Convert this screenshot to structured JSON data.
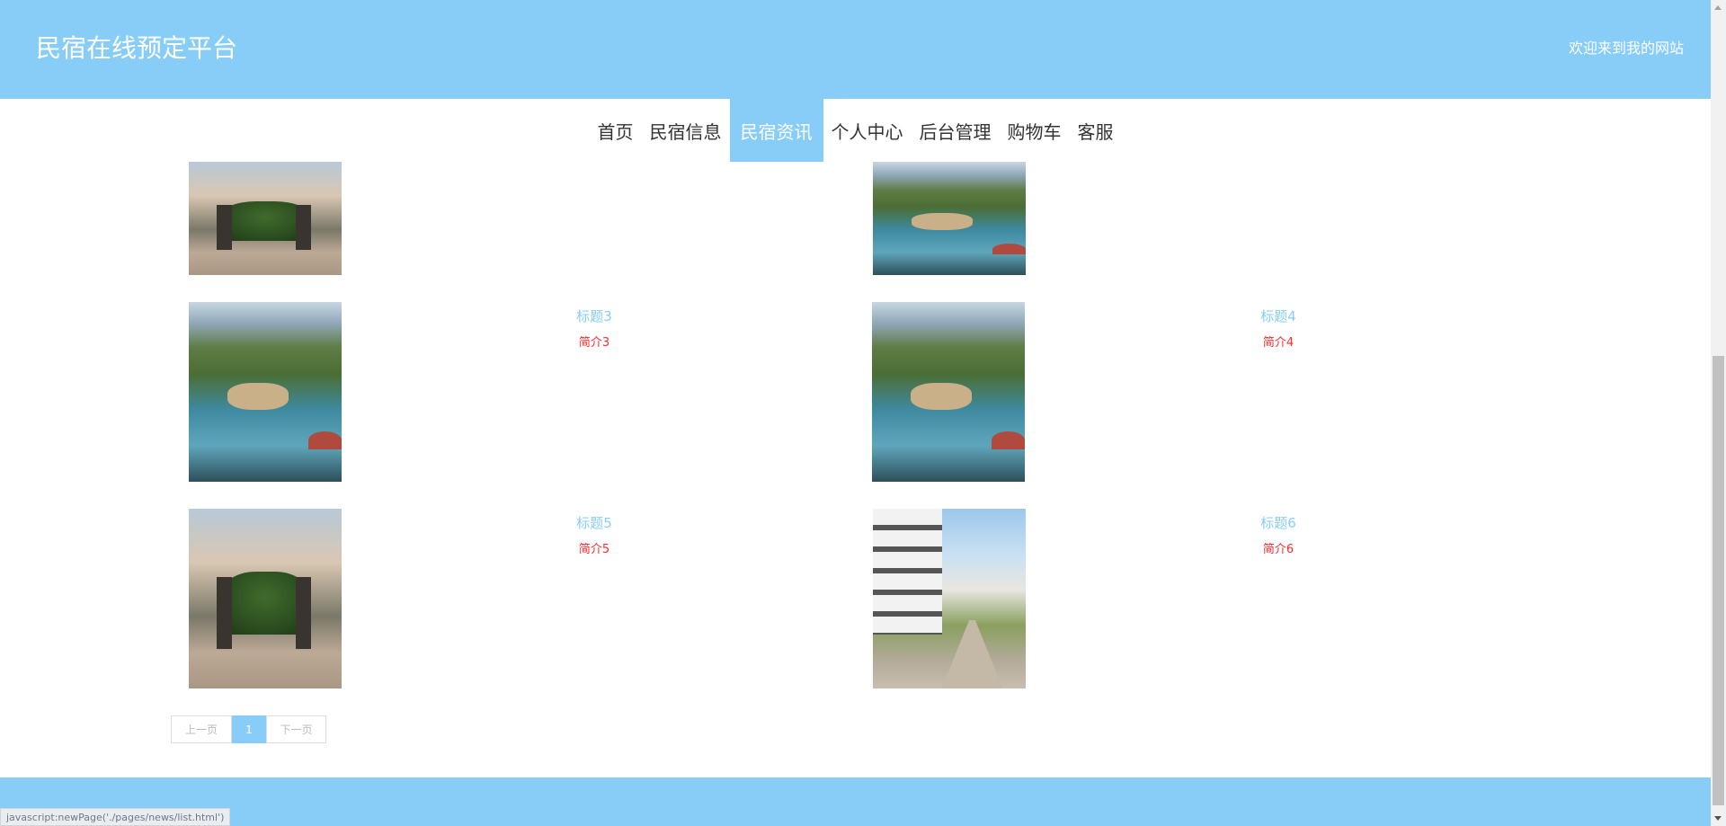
{
  "header": {
    "site_title": "民宿在线预定平台",
    "welcome": "欢迎来到我的网站"
  },
  "nav": {
    "items": [
      {
        "label": "首页",
        "active": false
      },
      {
        "label": "民宿信息",
        "active": false
      },
      {
        "label": "民宿资讯",
        "active": true
      },
      {
        "label": "个人中心",
        "active": false
      },
      {
        "label": "后台管理",
        "active": false
      },
      {
        "label": "购物车",
        "active": false
      },
      {
        "label": "客服",
        "active": false
      }
    ]
  },
  "news": {
    "items": [
      {
        "title": "",
        "summary": "",
        "image": "gate-photo"
      },
      {
        "title": "",
        "summary": "",
        "image": "pond-photo"
      },
      {
        "title": "标题3",
        "summary": "简介3",
        "image": "pond-photo"
      },
      {
        "title": "标题4",
        "summary": "简介4",
        "image": "pond-photo"
      },
      {
        "title": "标题5",
        "summary": "简介5",
        "image": "gate-photo"
      },
      {
        "title": "标题6",
        "summary": "简介6",
        "image": "street-photo"
      }
    ]
  },
  "pagination": {
    "prev_label": "上一页",
    "current_page": "1",
    "next_label": "下一页"
  },
  "status_bar": {
    "text": "javascript:newPage('./pages/news/list.html')"
  },
  "colors": {
    "primary": "#87cdf7",
    "summary_red": "#ff2a2a"
  }
}
